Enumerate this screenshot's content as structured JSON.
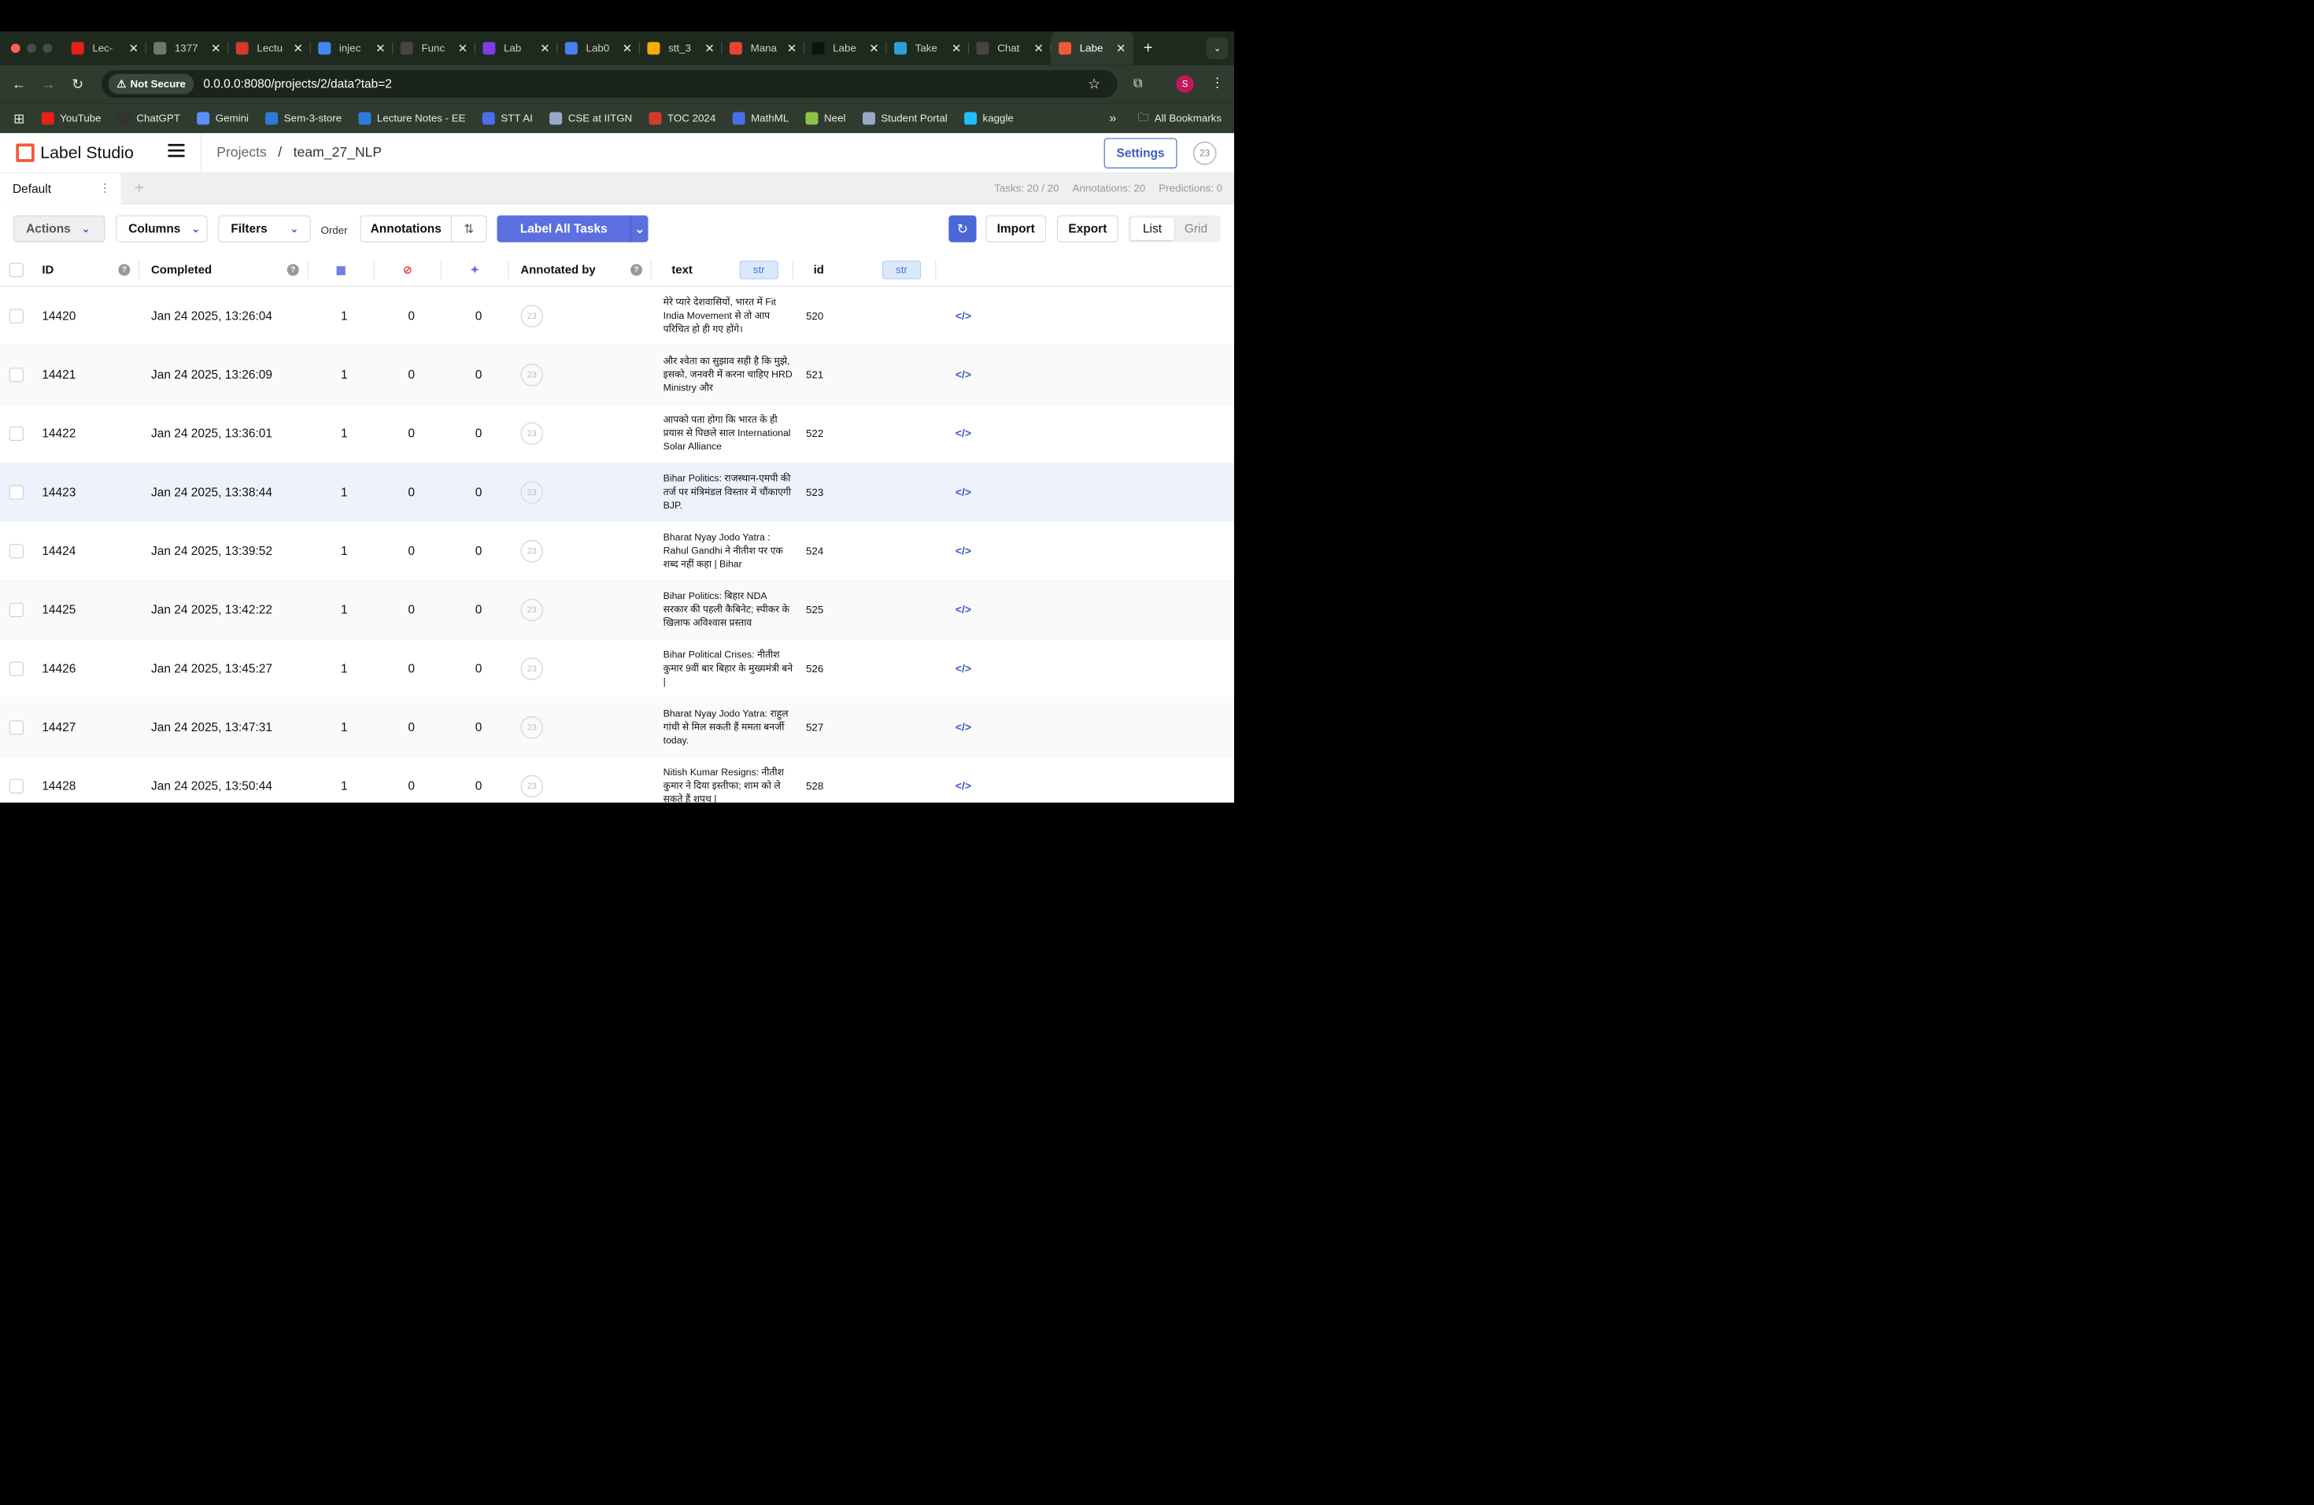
{
  "browser": {
    "tabs": [
      {
        "title": "Lec-",
        "icon": "youtube-icon",
        "color": "#e62117"
      },
      {
        "title": "1377",
        "icon": "globe-icon",
        "color": "#6b7a6b"
      },
      {
        "title": "Lectu",
        "icon": "lecture-icon",
        "color": "#d33a2c"
      },
      {
        "title": "injec",
        "icon": "google-icon",
        "color": "#4285f4"
      },
      {
        "title": "Func",
        "icon": "openai-icon",
        "color": "#444"
      },
      {
        "title": "Lab",
        "icon": "lab-icon",
        "color": "#7b3fe4"
      },
      {
        "title": "Lab0",
        "icon": "docs-icon",
        "color": "#4a7ef0"
      },
      {
        "title": "stt_3",
        "icon": "colab-icon",
        "color": "#f9ab00"
      },
      {
        "title": "Mana",
        "icon": "gmail-icon",
        "color": "#ea4335"
      },
      {
        "title": "Labe",
        "icon": "github-icon",
        "color": "#111"
      },
      {
        "title": "Take",
        "icon": "classroom-icon",
        "color": "#2aa0d8"
      },
      {
        "title": "Chat",
        "icon": "openai-icon",
        "color": "#444"
      },
      {
        "title": "Labe",
        "icon": "label-studio-icon",
        "color": "#f05a3a"
      }
    ],
    "not_secure": "Not Secure",
    "url": "0.0.0.0:8080/projects/2/data?tab=2",
    "profile_initial": "S",
    "bookmarks": [
      {
        "label": "YouTube",
        "icon": "youtube-icon",
        "color": "#e62117"
      },
      {
        "label": "ChatGPT",
        "icon": "openai-icon",
        "color": "#333"
      },
      {
        "label": "Gemini",
        "icon": "gemini-icon",
        "color": "#5b8ff9"
      },
      {
        "label": "Sem-3-store",
        "icon": "onedrive-icon",
        "color": "#2f7ad8"
      },
      {
        "label": "Lecture Notes - EE",
        "icon": "onedrive-icon",
        "color": "#2f7ad8"
      },
      {
        "label": "STT AI",
        "icon": "forms-icon",
        "color": "#4a6de8"
      },
      {
        "label": "CSE at IITGN",
        "icon": "iitgn-icon",
        "color": "#9aa8c8"
      },
      {
        "label": "TOC 2024",
        "icon": "toc-icon",
        "color": "#d33a2c"
      },
      {
        "label": "MathML",
        "icon": "forms-icon",
        "color": "#4a6de8"
      },
      {
        "label": "Neel",
        "icon": "neel-icon",
        "color": "#8bc34a"
      },
      {
        "label": "Student Portal",
        "icon": "iitgn-icon",
        "color": "#9aa8c8"
      },
      {
        "label": "kaggle",
        "icon": "kaggle-icon",
        "color": "#20beff"
      }
    ],
    "all_bookmarks": "All Bookmarks"
  },
  "app": {
    "logo": "Label Studio",
    "breadcrumb": {
      "projects": "Projects",
      "separator": "/",
      "project": "team_27_NLP"
    },
    "settings": "Settings",
    "avatar": "23"
  },
  "view_tab": {
    "label": "Default"
  },
  "stats": {
    "tasks": "Tasks: 20 / 20",
    "annotations": "Annotations: 20",
    "predictions": "Predictions: 0"
  },
  "toolbar": {
    "actions": "Actions",
    "columns": "Columns",
    "filters": "Filters",
    "order": "Order",
    "order_field": "Annotations",
    "label_all": "Label All Tasks",
    "import": "Import",
    "export": "Export",
    "list": "List",
    "grid": "Grid"
  },
  "table": {
    "headers": {
      "id": "ID",
      "completed": "Completed",
      "annotated_by": "Annotated by",
      "text": "text",
      "text_type": "str",
      "id2": "id",
      "id2_type": "str"
    },
    "rows": [
      {
        "id": "14420",
        "completed": "Jan 24 2025, 13:26:04",
        "total": "1",
        "cancelled": "0",
        "predictions": "0",
        "annotator": "23",
        "text": "मेरे प्यारे देशवासियों, भारत में Fit India Movement से तो आप परिचित हो ही गए होंगे।",
        "data_id": "520"
      },
      {
        "id": "14421",
        "completed": "Jan 24 2025, 13:26:09",
        "total": "1",
        "cancelled": "0",
        "predictions": "0",
        "annotator": "23",
        "text": "और श्वेता का सुझाव सही है कि मुझे, इसको, जनवरी में करना चाहिए HRD Ministry और",
        "data_id": "521"
      },
      {
        "id": "14422",
        "completed": "Jan 24 2025, 13:36:01",
        "total": "1",
        "cancelled": "0",
        "predictions": "0",
        "annotator": "23",
        "text": "आपको पता होगा कि भारत के ही प्रयास से पिछले साल International Solar Alliance",
        "data_id": "522"
      },
      {
        "id": "14423",
        "completed": "Jan 24 2025, 13:38:44",
        "total": "1",
        "cancelled": "0",
        "predictions": "0",
        "annotator": "23",
        "text": "Bihar Politics: राजस्थान-एमपी की तर्ज पर मंत्रिमंडल विस्तार में चौंकाएगी BJP.",
        "data_id": "523"
      },
      {
        "id": "14424",
        "completed": "Jan 24 2025, 13:39:52",
        "total": "1",
        "cancelled": "0",
        "predictions": "0",
        "annotator": "23",
        "text": "Bharat Nyay Jodo Yatra : Rahul Gandhi ने नीतीश पर एक शब्द नहीं कहा | Bihar",
        "data_id": "524"
      },
      {
        "id": "14425",
        "completed": "Jan 24 2025, 13:42:22",
        "total": "1",
        "cancelled": "0",
        "predictions": "0",
        "annotator": "23",
        "text": "Bihar Politics: बिहार NDA सरकार की पहली कैबिनेट; स्पीकर के खिलाफ अविश्वास प्रस्ताव",
        "data_id": "525"
      },
      {
        "id": "14426",
        "completed": "Jan 24 2025, 13:45:27",
        "total": "1",
        "cancelled": "0",
        "predictions": "0",
        "annotator": "23",
        "text": "Bihar Political Crises: नीतीश कुमार 9वीं बार बिहार के मुख्यमंत्री बने |",
        "data_id": "526"
      },
      {
        "id": "14427",
        "completed": "Jan 24 2025, 13:47:31",
        "total": "1",
        "cancelled": "0",
        "predictions": "0",
        "annotator": "23",
        "text": "Bharat Nyay Jodo Yatra: राहुल गांधी से मिल सकती हैं ममता बनर्जी today.",
        "data_id": "527"
      },
      {
        "id": "14428",
        "completed": "Jan 24 2025, 13:50:44",
        "total": "1",
        "cancelled": "0",
        "predictions": "0",
        "annotator": "23",
        "text": "Nitish Kumar Resigns: नीतीश कुमार ने दिया इस्तीफा; शाम को ले सकते हैं शपथ |",
        "data_id": "528"
      }
    ]
  }
}
